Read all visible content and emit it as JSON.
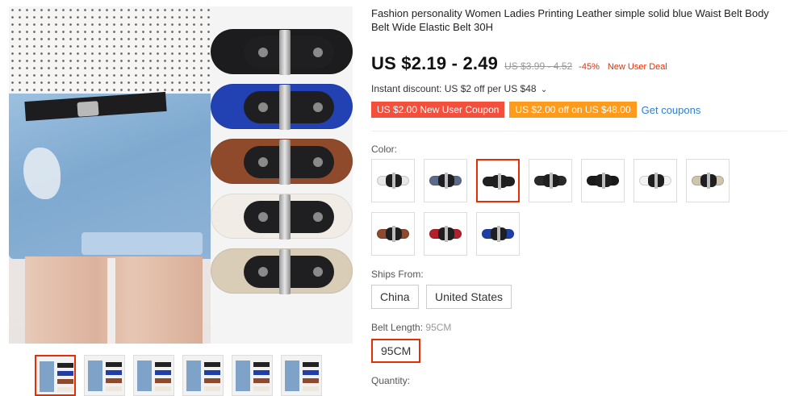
{
  "product": {
    "title": "Fashion personality Women Ladies Printing Leather simple solid blue Waist Belt Body Belt Wide Elastic Belt 30H",
    "price": "US $2.19 - 2.49",
    "original_price": "US $3.99 - 4.52",
    "discount": "-45%",
    "deal_badge": "New User Deal",
    "instant_discount": "Instant discount: US $2 off per US $48",
    "coupons": [
      "US $2.00 New User Coupon",
      "US $2.00 off on US $48.00"
    ],
    "get_coupons_label": "Get coupons"
  },
  "options": {
    "color_label": "Color:",
    "colors": [
      {
        "name": "white-gray",
        "hex": "#e8e8e8",
        "selected": false
      },
      {
        "name": "slate-blue",
        "hex": "#5b6b8a",
        "selected": false
      },
      {
        "name": "black",
        "hex": "#202020",
        "selected": true
      },
      {
        "name": "black-2",
        "hex": "#2a2a2a",
        "selected": false
      },
      {
        "name": "black-3",
        "hex": "#1a1a1a",
        "selected": false
      },
      {
        "name": "white",
        "hex": "#f2f2f2",
        "selected": false
      },
      {
        "name": "beige",
        "hex": "#cfc4ae",
        "selected": false
      },
      {
        "name": "brown",
        "hex": "#8d4a2c",
        "selected": false
      },
      {
        "name": "red",
        "hex": "#b3202b",
        "selected": false
      },
      {
        "name": "blue",
        "hex": "#1f3fa6",
        "selected": false
      }
    ],
    "ships_from_label": "Ships From:",
    "ships_from": [
      {
        "label": "China",
        "selected": false
      },
      {
        "label": "United States",
        "selected": false
      }
    ],
    "length_label": "Belt Length:",
    "length_value": "95CM",
    "lengths": [
      {
        "label": "95CM",
        "selected": true
      }
    ],
    "quantity_label": "Quantity:"
  },
  "gallery": {
    "thumbnails": [
      "thumb-1",
      "thumb-2",
      "thumb-3",
      "thumb-4",
      "thumb-5",
      "thumb-6"
    ],
    "belt_colors": [
      "#1c1c1e",
      "#2242b4",
      "#8e4a2b",
      "#f1ede6",
      "#d9cdb7"
    ]
  },
  "colors": {
    "accent": "#e62e04",
    "coupon_red": "#f24f3d",
    "coupon_orange": "#ff9a1a",
    "link": "#2b7fd4"
  }
}
